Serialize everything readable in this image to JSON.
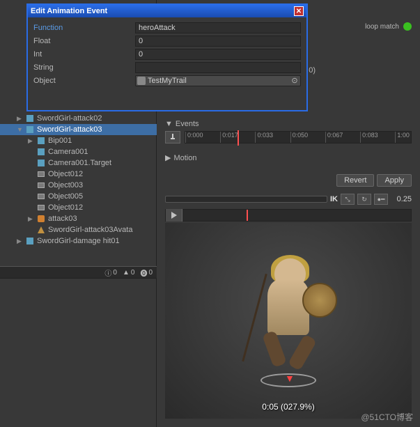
{
  "dialog": {
    "title": "Edit Animation Event",
    "fields": {
      "function_label": "Function",
      "function_value": "heroAttack",
      "float_label": "Float",
      "float_value": "0",
      "int_label": "Int",
      "int_value": "0",
      "string_label": "String",
      "string_value": "",
      "object_label": "Object",
      "object_value": "TestMyTrail"
    }
  },
  "hierarchy": [
    {
      "label": "SwordGirl-attack02",
      "indent": 1,
      "icon": "cube",
      "arrow": "▶",
      "selected": false
    },
    {
      "label": "SwordGirl-attack03",
      "indent": 1,
      "icon": "cube",
      "arrow": "▼",
      "selected": true
    },
    {
      "label": "Bip001",
      "indent": 2,
      "icon": "cube",
      "arrow": "▶",
      "selected": false
    },
    {
      "label": "Camera001",
      "indent": 2,
      "icon": "cube",
      "arrow": "",
      "selected": false
    },
    {
      "label": "Camera001.Target",
      "indent": 2,
      "icon": "cube",
      "arrow": "",
      "selected": false
    },
    {
      "label": "Object012",
      "indent": 2,
      "icon": "mesh",
      "arrow": "",
      "selected": false
    },
    {
      "label": "Object003",
      "indent": 2,
      "icon": "mesh",
      "arrow": "",
      "selected": false
    },
    {
      "label": "Object005",
      "indent": 2,
      "icon": "mesh",
      "arrow": "",
      "selected": false
    },
    {
      "label": "Object012",
      "indent": 2,
      "icon": "mesh",
      "arrow": "",
      "selected": false
    },
    {
      "label": "attack03",
      "indent": 2,
      "icon": "anim",
      "arrow": "▶",
      "selected": false
    },
    {
      "label": "SwordGirl-attack03Avata",
      "indent": 2,
      "icon": "avatar",
      "arrow": "",
      "selected": false
    },
    {
      "label": "SwordGirl-damage hit01",
      "indent": 1,
      "icon": "cube",
      "arrow": "▶",
      "selected": false
    }
  ],
  "status": {
    "info": "0",
    "warn": "0",
    "error": "0"
  },
  "right": {
    "loop_match": "loop match",
    "events_label": "Events",
    "motion_label": "Motion",
    "revert": "Revert",
    "apply": "Apply",
    "ik_label": "IK",
    "speed": "0.25",
    "timeline_ticks": [
      "0:000",
      "0:017",
      "0:033",
      "0:050",
      "0:067",
      "0:083",
      "1:00"
    ],
    "preview_time": "0:05 (027.9%)",
    "extra_text": "0)"
  },
  "watermark": "@51CTO博客"
}
